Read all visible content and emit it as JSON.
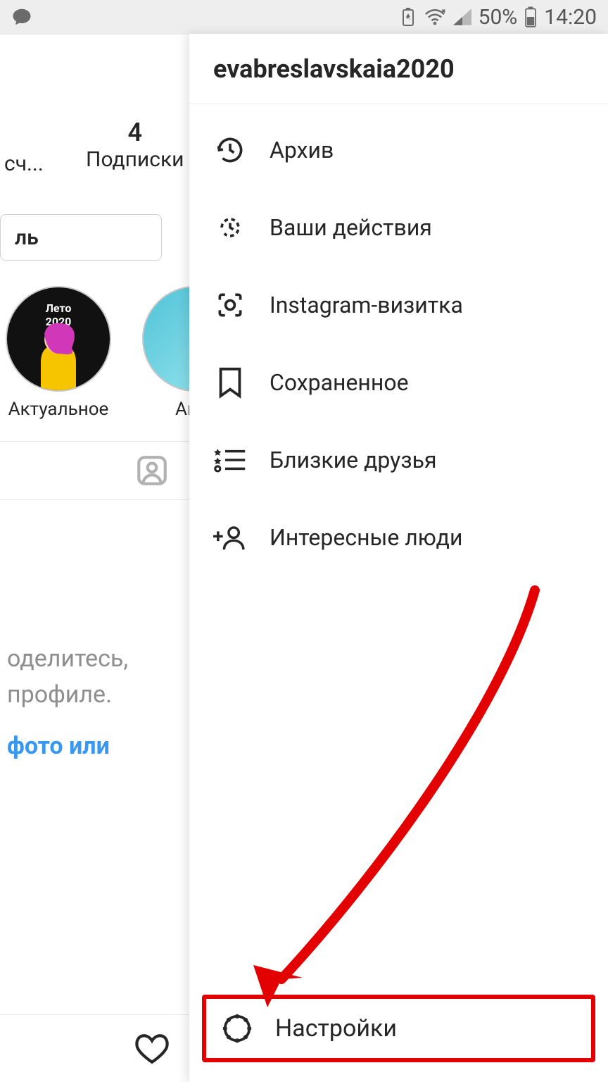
{
  "status": {
    "battery_pct": "50%",
    "time": "14:20"
  },
  "profile": {
    "following_count": "4",
    "following_label": "Подписки",
    "truncated_stat": "сч...",
    "edit_button": "ль",
    "highlight1_label": "Актуальное",
    "highlight1_tag": "Лето 2020",
    "highlight2_label": "Акту",
    "hint_line1": "оделитесь,",
    "hint_line2": "профиле.",
    "hint_link": "фото или"
  },
  "drawer": {
    "username": "evabreslavskaia2020",
    "items": [
      {
        "icon": "history-icon",
        "label": "Архив"
      },
      {
        "icon": "activity-icon",
        "label": "Ваши действия"
      },
      {
        "icon": "nametag-icon",
        "label": "Instagram-визитка"
      },
      {
        "icon": "bookmark-icon",
        "label": "Сохраненное"
      },
      {
        "icon": "close-friends-icon",
        "label": "Близкие друзья"
      },
      {
        "icon": "discover-people-icon",
        "label": "Интересные люди"
      }
    ],
    "settings_label": "Настройки"
  }
}
